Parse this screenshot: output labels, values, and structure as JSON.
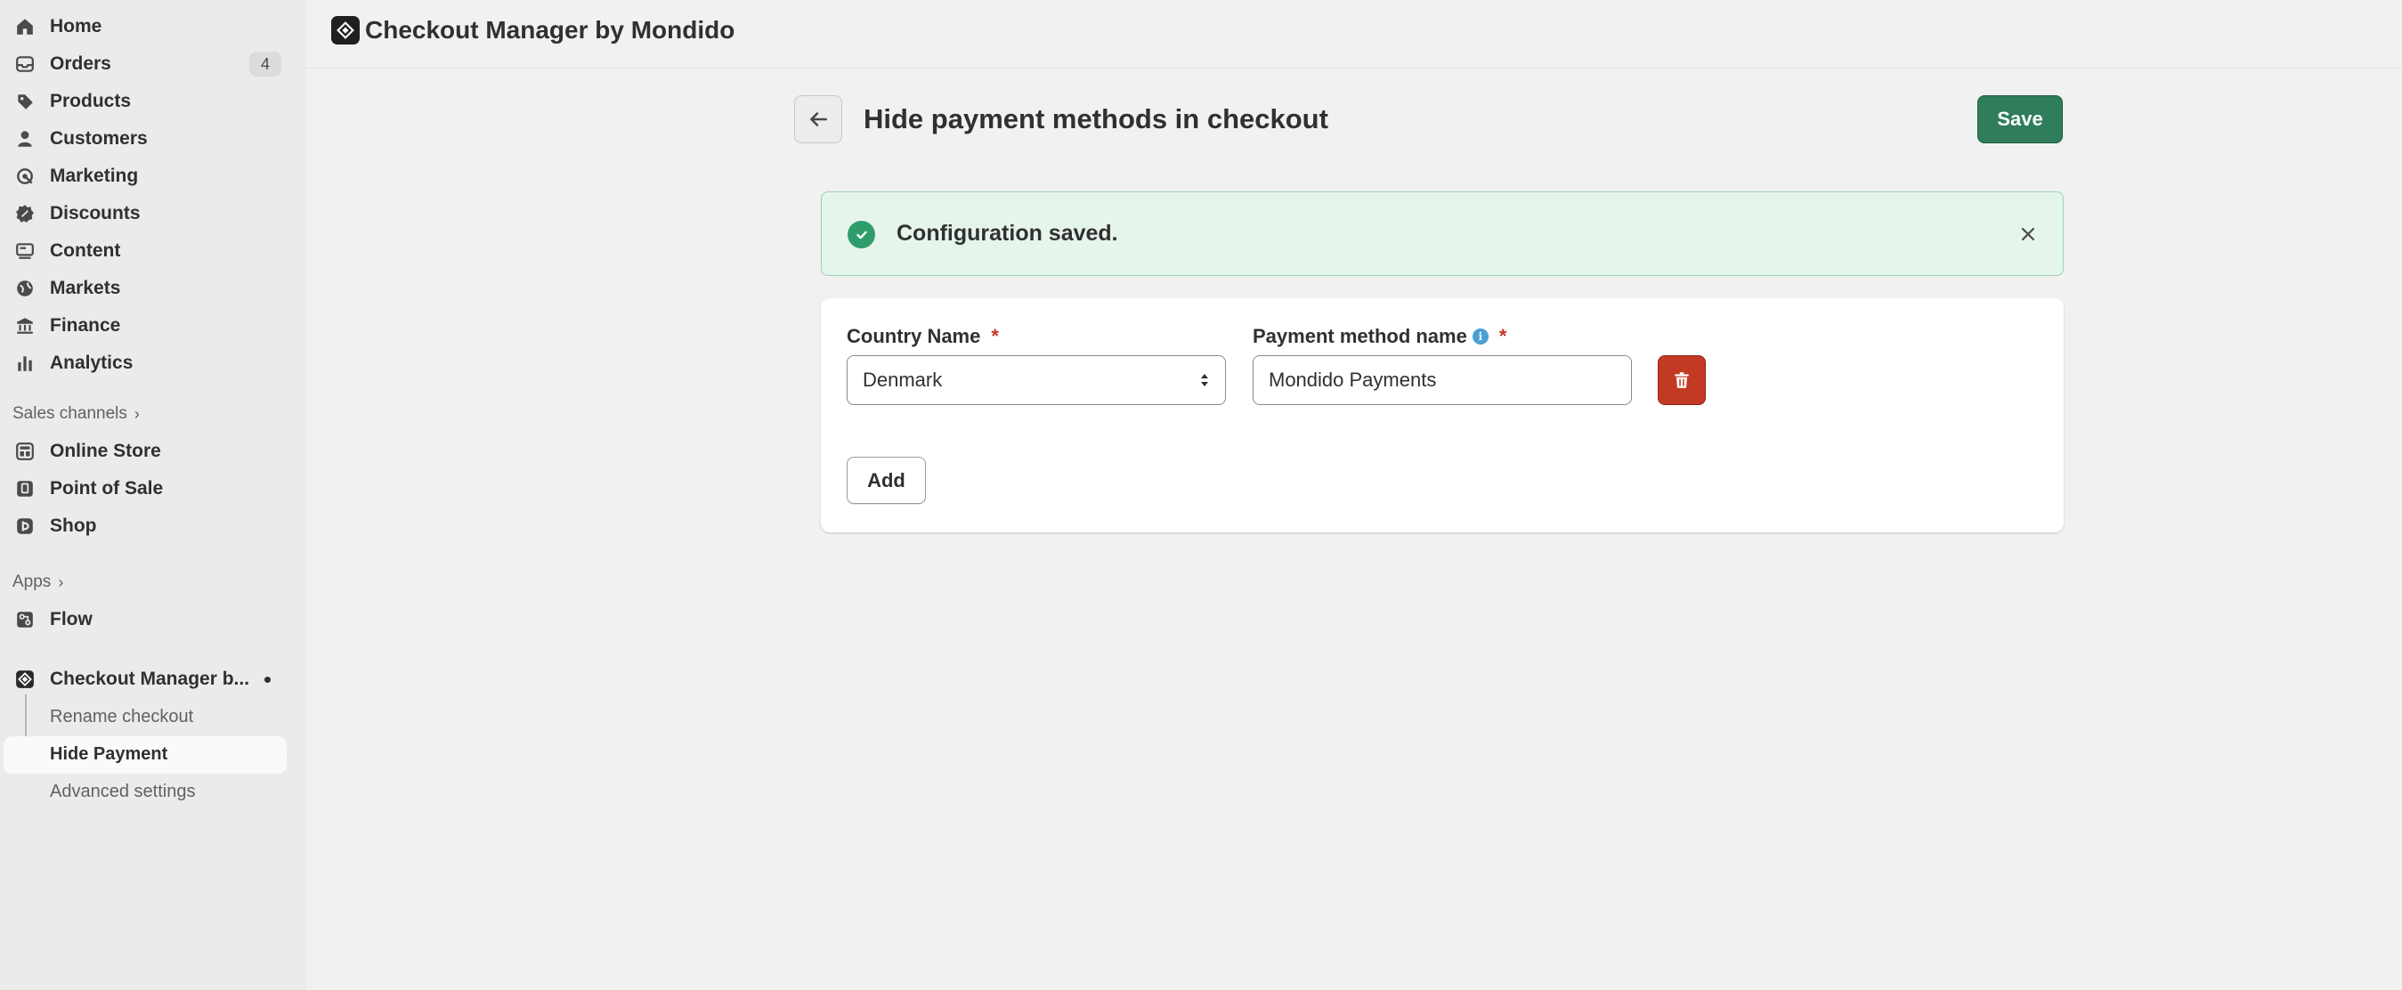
{
  "sidebar": {
    "items": [
      {
        "label": "Home",
        "icon": "home-icon"
      },
      {
        "label": "Orders",
        "icon": "orders-icon",
        "badge": "4"
      },
      {
        "label": "Products",
        "icon": "tag-icon"
      },
      {
        "label": "Customers",
        "icon": "person-icon"
      },
      {
        "label": "Marketing",
        "icon": "target-icon"
      },
      {
        "label": "Discounts",
        "icon": "discount-icon"
      },
      {
        "label": "Content",
        "icon": "content-icon"
      },
      {
        "label": "Markets",
        "icon": "globe-icon"
      },
      {
        "label": "Finance",
        "icon": "bank-icon"
      },
      {
        "label": "Analytics",
        "icon": "bar-chart-icon"
      }
    ],
    "sales_channels_heading": "Sales channels",
    "channels": [
      {
        "label": "Online Store",
        "icon": "store-icon"
      },
      {
        "label": "Point of Sale",
        "icon": "pos-icon"
      },
      {
        "label": "Shop",
        "icon": "shop-icon"
      }
    ],
    "apps_heading": "Apps",
    "apps": [
      {
        "label": "Flow",
        "icon": "flow-icon"
      },
      {
        "label": "Checkout Manager b...",
        "icon": "mondido-icon"
      }
    ],
    "app_sub_items": [
      {
        "label": "Rename checkout"
      },
      {
        "label": "Hide Payment",
        "active": true
      },
      {
        "label": "Advanced settings"
      }
    ]
  },
  "header": {
    "app_title": "Checkout Manager by Mondido"
  },
  "page": {
    "title": "Hide payment methods in checkout",
    "save_label": "Save"
  },
  "banner": {
    "message": "Configuration saved.",
    "status_color": "#2f9d6b"
  },
  "form": {
    "country_label": "Country Name",
    "country_value": "Denmark",
    "payment_label": "Payment method name",
    "payment_value": "Mondido Payments",
    "required_marker": "*",
    "info_glyph": "i",
    "add_label": "Add"
  },
  "colors": {
    "primary": "#2f7d5b",
    "critical": "#c23a23",
    "success_bg": "#e6f5ec"
  }
}
